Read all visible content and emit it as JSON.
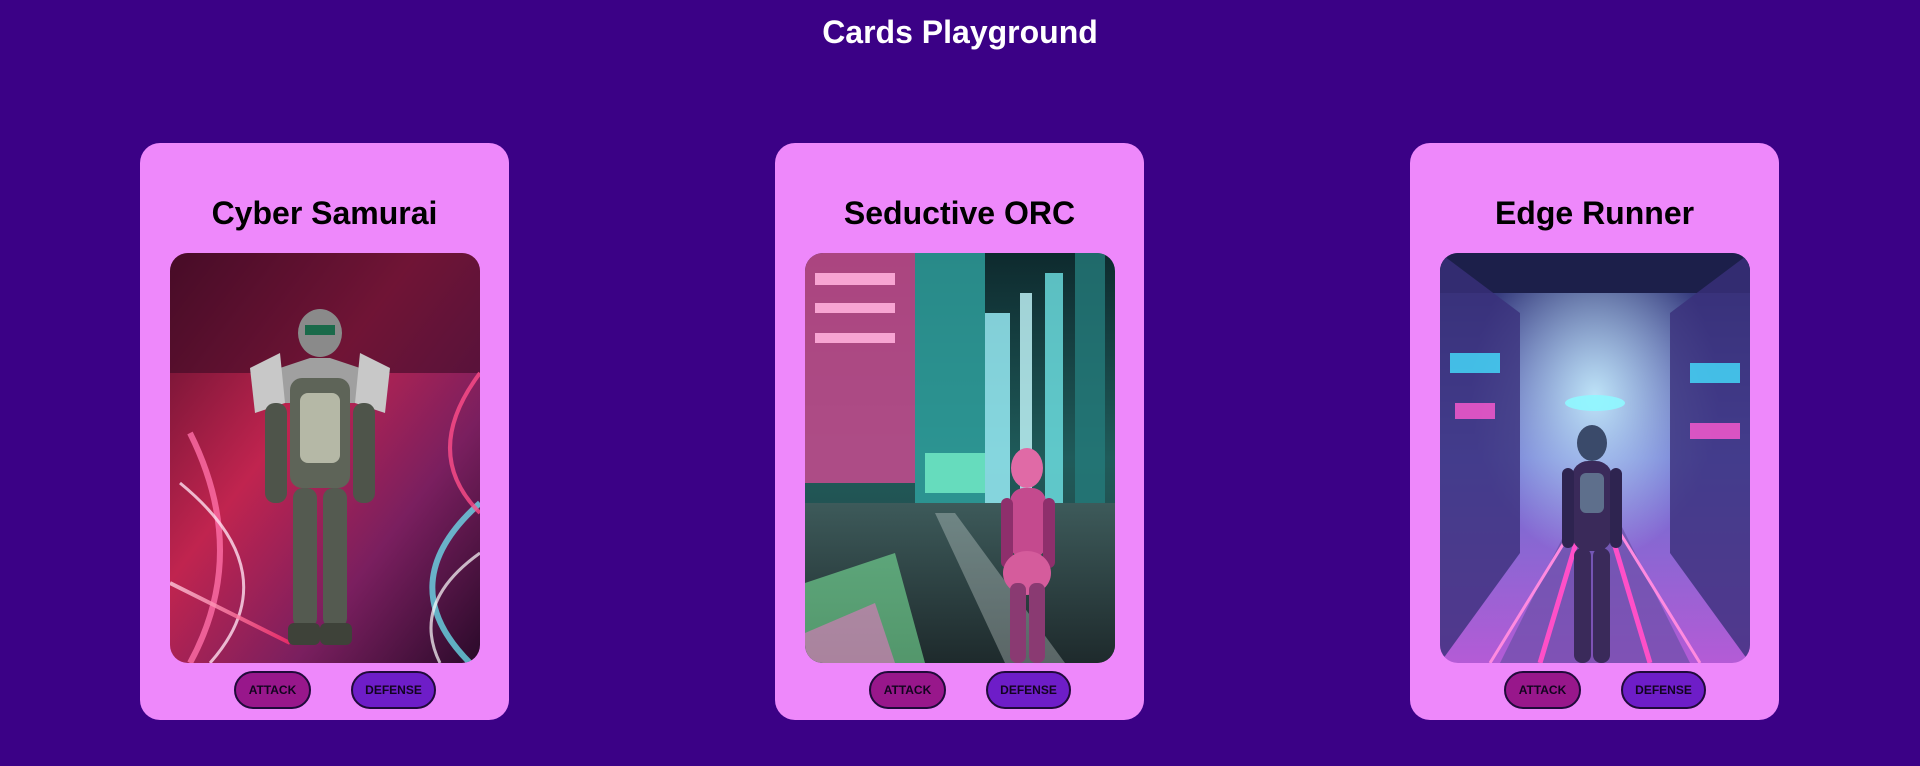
{
  "page": {
    "title": "Cards Playground",
    "background": "#3b0186"
  },
  "colors": {
    "card": "#ee88fb",
    "attack": "#98178b",
    "defense": "#6e1dc8"
  },
  "cards": [
    {
      "title": "Cyber Samurai",
      "image_icon": "armored-cyborg-warrior-neon-street-image",
      "attack_label": "ATTACK",
      "defense_label": "DEFENSE"
    },
    {
      "title": "Seductive ORC",
      "image_icon": "cyborg-woman-neon-city-street-image",
      "attack_label": "ATTACK",
      "defense_label": "DEFENSE"
    },
    {
      "title": "Edge Runner",
      "image_icon": "runner-neon-corridor-image",
      "attack_label": "ATTACK",
      "defense_label": "DEFENSE"
    }
  ]
}
